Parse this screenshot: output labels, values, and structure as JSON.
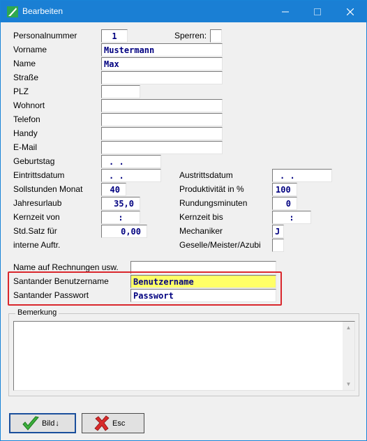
{
  "window": {
    "title": "Bearbeiten"
  },
  "form": {
    "personalnummer": {
      "label": "Personalnummer",
      "value": "1"
    },
    "sperren": {
      "label": "Sperren:",
      "value": ""
    },
    "vorname": {
      "label": "Vorname",
      "value": "Mustermann"
    },
    "name": {
      "label": "Name",
      "value": "Max"
    },
    "strasse": {
      "label": "Straße",
      "value": ""
    },
    "plz": {
      "label": "PLZ",
      "value": ""
    },
    "wohnort": {
      "label": "Wohnort",
      "value": ""
    },
    "telefon": {
      "label": "Telefon",
      "value": ""
    },
    "handy": {
      "label": "Handy",
      "value": ""
    },
    "email": {
      "label": "E-Mail",
      "value": ""
    },
    "geburtstag": {
      "label": "Geburtstag",
      "value": ". ."
    },
    "eintrittsdatum": {
      "label": "Eintrittsdatum",
      "value": ". ."
    },
    "austrittsdatum": {
      "label": "Austrittsdatum",
      "value": ". ."
    },
    "sollstunden": {
      "label": "Sollstunden Monat",
      "value": "40"
    },
    "produktivitaet": {
      "label": "Produktivität in %",
      "value": "100"
    },
    "jahresurlaub": {
      "label": "Jahresurlaub",
      "value": "35,0"
    },
    "rundungsminuten": {
      "label": "Rundungsminuten",
      "value": "0"
    },
    "kernzeit_von": {
      "label": "Kernzeit von",
      "value": ":"
    },
    "kernzeit_bis": {
      "label": "Kernzeit bis",
      "value": ":"
    },
    "std_satz": {
      "label_line1": "Std.Satz für",
      "label_line2": "interne Auftr.",
      "value": "0,00"
    },
    "mechaniker": {
      "label": "Mechaniker",
      "value": "J"
    },
    "geselle": {
      "label": "Geselle/Meister/Azubi",
      "value": ""
    },
    "name_rechnungen": {
      "label": "Name auf Rechnungen usw.",
      "value": ""
    },
    "santander_user": {
      "label": "Santander Benutzername",
      "value": "Benutzername"
    },
    "santander_pass": {
      "label": "Santander Passwort",
      "value": "Passwort"
    },
    "bemerkung": {
      "label": "Bemerkung",
      "value": ""
    }
  },
  "buttons": {
    "bild": {
      "label": "Bild",
      "arrow": "↓"
    },
    "esc": {
      "label": "Esc"
    }
  },
  "colors": {
    "titlebar": "#1a7fd4",
    "field_text": "#000080",
    "highlight_field": "#ffff66",
    "highlight_box": "#d9272c"
  }
}
